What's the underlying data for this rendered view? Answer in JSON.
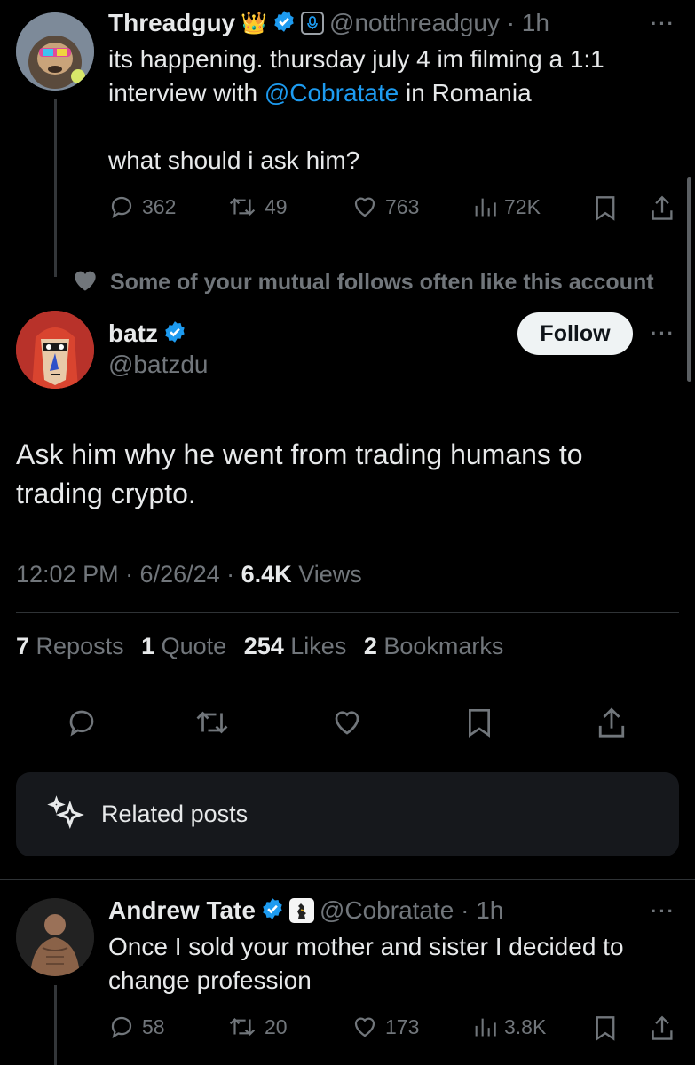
{
  "tweet1": {
    "name": "Threadguy",
    "badge_emoji": "👑",
    "handle_time": "@notthreadguy · 1h",
    "line1": "its happening. thursday july 4 im filming a 1:1",
    "line2_pre": "interview with ",
    "line2_mention": "@Cobratate",
    "line2_post": " in Romania",
    "line3": "what should i ask him?",
    "replies": "362",
    "reposts": "49",
    "likes": "763",
    "views": "72K"
  },
  "social_context": "Some of your mutual follows often like this account",
  "main": {
    "name": "batz",
    "handle": "@batzdu",
    "follow_label": "Follow",
    "text_line1": "Ask him why he went from trading humans to",
    "text_line2": "trading crypto.",
    "meta_time": "12:02 PM · 6/26/24 · ",
    "views_count": "6.4K",
    "views_label": " Views",
    "reposts_count": "7",
    "reposts_label": " Reposts",
    "quote_count": "1",
    "quote_label": " Quote",
    "likes_count": "254",
    "likes_label": " Likes",
    "bookmarks_count": "2",
    "bookmarks_label": " Bookmarks"
  },
  "related_label": "Related posts",
  "tweet3": {
    "name": "Andrew Tate",
    "handle_time": "@Cobratate · 1h",
    "line1": "Once I sold your mother and sister I decided to",
    "line2": "change profession",
    "replies": "58",
    "reposts": "20",
    "likes": "173",
    "views": "3.8K"
  },
  "icons": [
    "reply-icon",
    "repost-icon",
    "like-icon",
    "views-icon",
    "bookmark-icon",
    "share-icon",
    "verified-icon",
    "sparkle-icon",
    "heart-icon",
    "more-icon"
  ],
  "colors": {
    "accent": "#1d9bf0",
    "muted": "#71767b",
    "text": "#e7e9ea",
    "background": "#000000"
  }
}
